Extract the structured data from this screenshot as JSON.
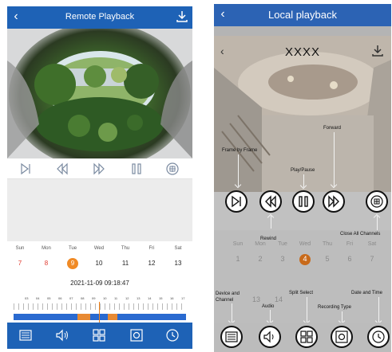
{
  "left": {
    "header": {
      "back_icon": "chevron-left-icon",
      "title": "Remote Playback",
      "download_icon": "download-icon"
    },
    "controls": [
      "frame-by-frame-icon",
      "rewind-icon",
      "forward-icon",
      "play-pause-icon",
      "close-all-channels-icon"
    ],
    "calendar": {
      "weekdays": [
        "Sun",
        "Mon",
        "Tue",
        "Wed",
        "Thu",
        "Fri",
        "Sat"
      ],
      "days": [
        "7",
        "8",
        "9",
        "10",
        "11",
        "12",
        "13"
      ],
      "selected_day": "9",
      "datetime": "2021-11-09 09:18:47"
    },
    "timeline": {
      "labels": [
        "03",
        "04",
        "05",
        "06",
        "07",
        "08",
        "09",
        "10",
        "11",
        "12",
        "13",
        "14",
        "15",
        "16",
        "17"
      ]
    },
    "bottom_bar": [
      "device-channel-icon",
      "audio-icon",
      "split-select-icon",
      "recording-type-icon",
      "date-time-icon"
    ],
    "colors": {
      "header": "#1e62b6",
      "accent": "#f08a25",
      "weekend": "#e03a2f"
    }
  },
  "right": {
    "header": {
      "back_icon": "chevron-left-icon",
      "title": "Local playback"
    },
    "sub_title": "XXXX",
    "annotations": {
      "frame_by_frame": "Frame by Frame",
      "forward": "Forward",
      "play_pause": "Play/Pause",
      "rewind": "Rewind",
      "close_all": "Close All Channels",
      "device_channel": "Device and\nChannel",
      "audio": "Audio",
      "split_select": "Split Select",
      "recording_type": "Recording Type",
      "date_time": "Date and Time"
    },
    "calendar": {
      "weekdays": [
        "Sun",
        "Mon",
        "Tue",
        "Wed",
        "Thu",
        "Fri",
        "Sat"
      ],
      "days": [
        "1",
        "2",
        "3",
        "4",
        "5",
        "6",
        "7"
      ],
      "selected_day": "4",
      "lower_days": [
        "13",
        "14"
      ]
    }
  }
}
